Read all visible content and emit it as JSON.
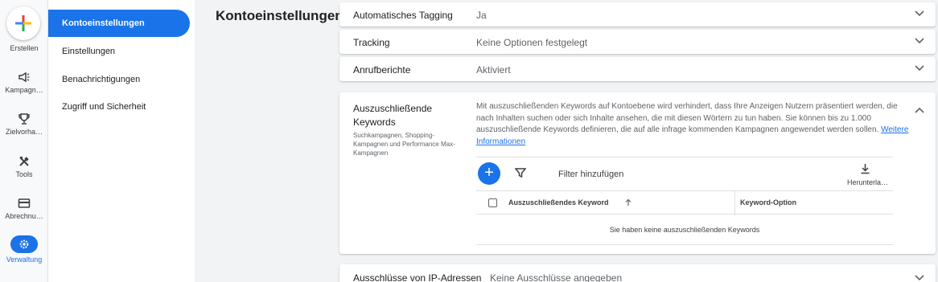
{
  "rail": {
    "create_label": "Erstellen",
    "items": [
      {
        "label": "Kampagn…"
      },
      {
        "label": "Zielvorha…"
      },
      {
        "label": "Tools"
      },
      {
        "label": "Abrechnu…"
      },
      {
        "label": "Verwaltung"
      }
    ]
  },
  "subnav": {
    "items": [
      {
        "label": "Kontoeinstellungen"
      },
      {
        "label": "Einstellungen"
      },
      {
        "label": "Benachrichtigungen"
      },
      {
        "label": "Zugriff und Sicherheit"
      }
    ]
  },
  "page": {
    "title": "Kontoeinstellungen"
  },
  "settings": {
    "tagging": {
      "label": "Automatisches Tagging",
      "value": "Ja"
    },
    "tracking": {
      "label": "Tracking",
      "value": "Keine Optionen festgelegt"
    },
    "calls": {
      "label": "Anrufberichte",
      "value": "Aktiviert"
    },
    "ip": {
      "label": "Ausschlüsse von IP-Adressen",
      "value": "Keine Ausschlüsse angegeben"
    }
  },
  "negative_keywords": {
    "title": "Auszuschließende Keywords",
    "subtitle": "Suchkampagnen, Shopping-Kampagnen und Performance Max-Kampagnen",
    "description": "Mit auszuschließenden Keywords auf Kontoebene wird verhindert, dass Ihre Anzeigen Nutzern präsentiert werden, die nach Inhalten suchen oder sich Inhalte ansehen, die mit diesen Wörtern zu tun haben. Sie können bis zu 1.000 auszuschließende Keywords definieren, die auf alle infrage kommenden Kampagnen angewendet werden sollen.",
    "link": "Weitere Informationen",
    "add_symbol": "+",
    "filter_label": "Filter hinzufügen",
    "download_label": "Herunterla…",
    "columns": [
      "Auszuschließendes Keyword",
      "Keyword-Option"
    ],
    "empty_text": "Sie haben keine auszuschließenden Keywords"
  },
  "colors": {
    "accent": "#1a73e8",
    "background": "#f1f3f4"
  }
}
